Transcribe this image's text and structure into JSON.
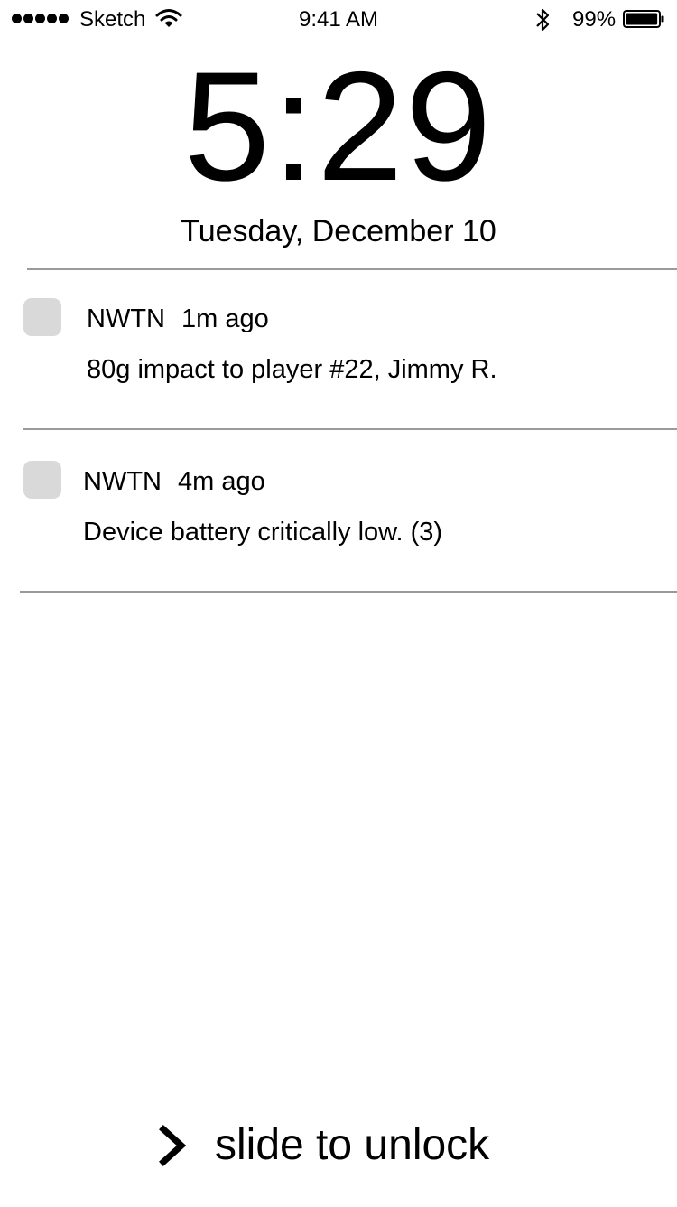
{
  "status_bar": {
    "signal_icon": "signal-dots-icon",
    "carrier": "Sketch",
    "wifi_icon": "wifi-icon",
    "time": "9:41 AM",
    "bluetooth_icon": "bluetooth-icon",
    "battery_percent": "99%",
    "battery_icon": "battery-icon",
    "battery_level": 0.99
  },
  "lock_screen": {
    "time": "5:29",
    "date": "Tuesday, December 10"
  },
  "notifications": [
    {
      "app": "NWTN",
      "age": "1m ago",
      "message": "80g impact to player #22, Jimmy R."
    },
    {
      "app": "NWTN",
      "age": "4m ago",
      "message": "Device battery critically low. (3)"
    }
  ],
  "unlock": {
    "icon": "chevron-right-icon",
    "label": "slide to unlock"
  },
  "colors": {
    "divider": "#9a9a9a",
    "app_icon_placeholder": "#d9d9d9",
    "text": "#000000",
    "background": "#ffffff"
  }
}
